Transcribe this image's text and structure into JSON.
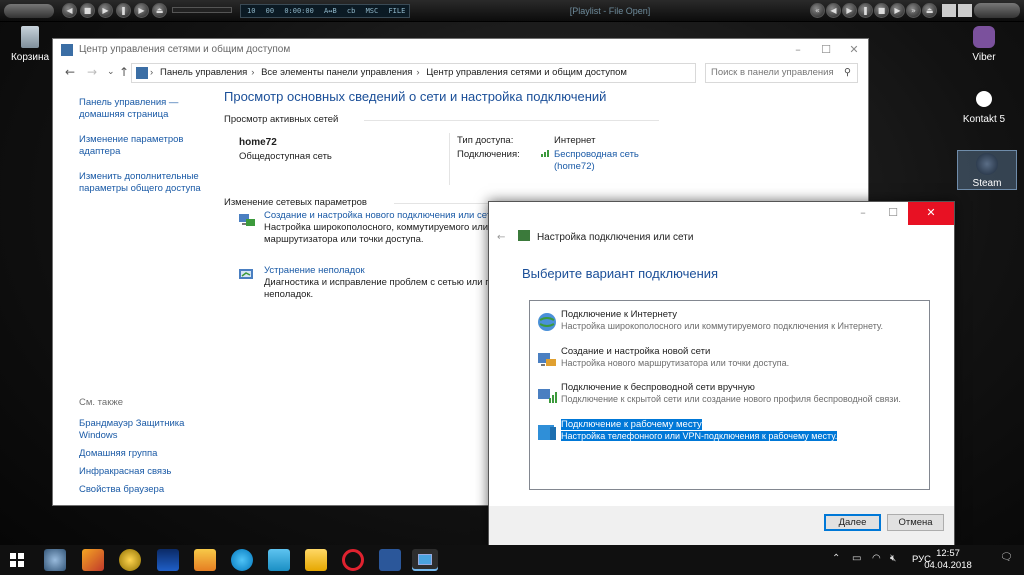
{
  "player": {
    "display_tracks": "10",
    "display_num": "00",
    "display_time": "0:00:00",
    "display_ab": "A↔B",
    "display_cb": "cb",
    "display_mode": "MSC",
    "display_flag": "FILE",
    "title": "[Playlist - File Open]"
  },
  "desktop": {
    "recycle_bin": "Корзина",
    "viber": "Viber",
    "kontakt": "Kontakt 5",
    "steam": "Steam"
  },
  "main_window": {
    "title": "Центр управления сетями и общим доступом",
    "address": [
      "Панель управления",
      "Все элементы панели управления",
      "Центр управления сетями и общим доступом"
    ],
    "search_placeholder": "Поиск в панели управления",
    "left_links": [
      "Панель управления — домашняя страница",
      "Изменение параметров адаптера",
      "Изменить дополнительные параметры общего доступа"
    ],
    "see_also_header": "См. также",
    "see_also": [
      "Брандмауэр Защитника Windows",
      "Домашняя группа",
      "Инфракрасная связь",
      "Свойства браузера"
    ],
    "heading": "Просмотр основных сведений о сети и настройка подключений",
    "active_networks_label": "Просмотр активных сетей",
    "network_name": "home72",
    "network_type": "Общедоступная сеть",
    "access_type_label": "Тип доступа:",
    "access_type_value": "Интернет",
    "connections_label": "Подключения:",
    "connection_value_1": "Беспроводная сеть",
    "connection_value_2": "(home72)",
    "change_settings_label": "Изменение сетевых параметров",
    "task1_title": "Создание и настройка нового подключения или сети",
    "task1_desc_1": "Настройка широкополосного, коммутируемого или VPN-подключения либо настройка",
    "task1_desc_2": "маршрутизатора или точки доступа.",
    "task2_title": "Устранение неполадок",
    "task2_desc_1": "Диагностика и исправление проблем с сетью или получение сведений об устранении",
    "task2_desc_2": "неполадок."
  },
  "dialog": {
    "nav_title": "Настройка подключения или сети",
    "heading": "Выберите вариант подключения",
    "options": [
      {
        "title": "Подключение к Интернету",
        "desc": "Настройка широкополосного или коммутируемого подключения к Интернету."
      },
      {
        "title": "Создание и настройка новой сети",
        "desc": "Настройка нового маршрутизатора или точки доступа."
      },
      {
        "title": "Подключение к беспроводной сети вручную",
        "desc": "Подключение к скрытой сети или создание нового профиля беспроводной связи."
      },
      {
        "title": "Подключение к рабочему месту",
        "desc": "Настройка телефонного или VPN-подключения к рабочему месту."
      }
    ],
    "selected_index": 3,
    "next_button": "Далее",
    "cancel_button": "Отмена"
  },
  "taskbar": {
    "language": "РУС",
    "time": "12:57",
    "date": "04.04.2018"
  },
  "colors": {
    "link": "#1a5aa6",
    "heading": "#1b4f98",
    "selection": "#0078d7",
    "close": "#e81123"
  }
}
